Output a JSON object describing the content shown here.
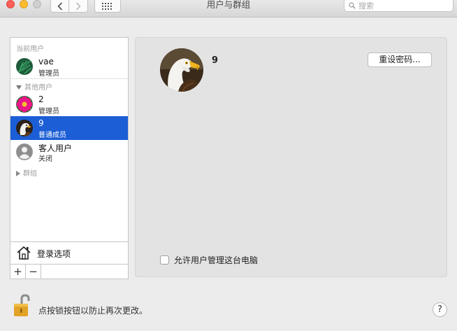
{
  "window": {
    "title": "用户与群组",
    "search_placeholder": "搜索"
  },
  "sidebar": {
    "current_users_label": "当前用户",
    "current_user": {
      "name": "vae",
      "role": "管理员",
      "avatar": "palm-leaf-icon"
    },
    "other_users_label": "其他用户",
    "other_users": [
      {
        "name": "2",
        "role": "管理员",
        "avatar": "flower-icon"
      },
      {
        "name": "9",
        "role": "普通成员",
        "avatar": "eagle-icon",
        "selected": true
      },
      {
        "name": "客人用户",
        "role": "关闭",
        "avatar": "guest-person-icon"
      }
    ],
    "groups_label": "群组",
    "login_options_label": "登录选项",
    "add_label": "+",
    "remove_label": "−"
  },
  "detail": {
    "user_name": "9",
    "reset_password_label": "重设密码...",
    "allow_admin_label": "允许用户管理这台电脑",
    "allow_admin_checked": false
  },
  "footer": {
    "lock_text": "点按锁按钮以防止再次更改。",
    "help_label": "?"
  },
  "colors": {
    "selection": "#1b5ed6",
    "window_bg": "#ececec"
  }
}
